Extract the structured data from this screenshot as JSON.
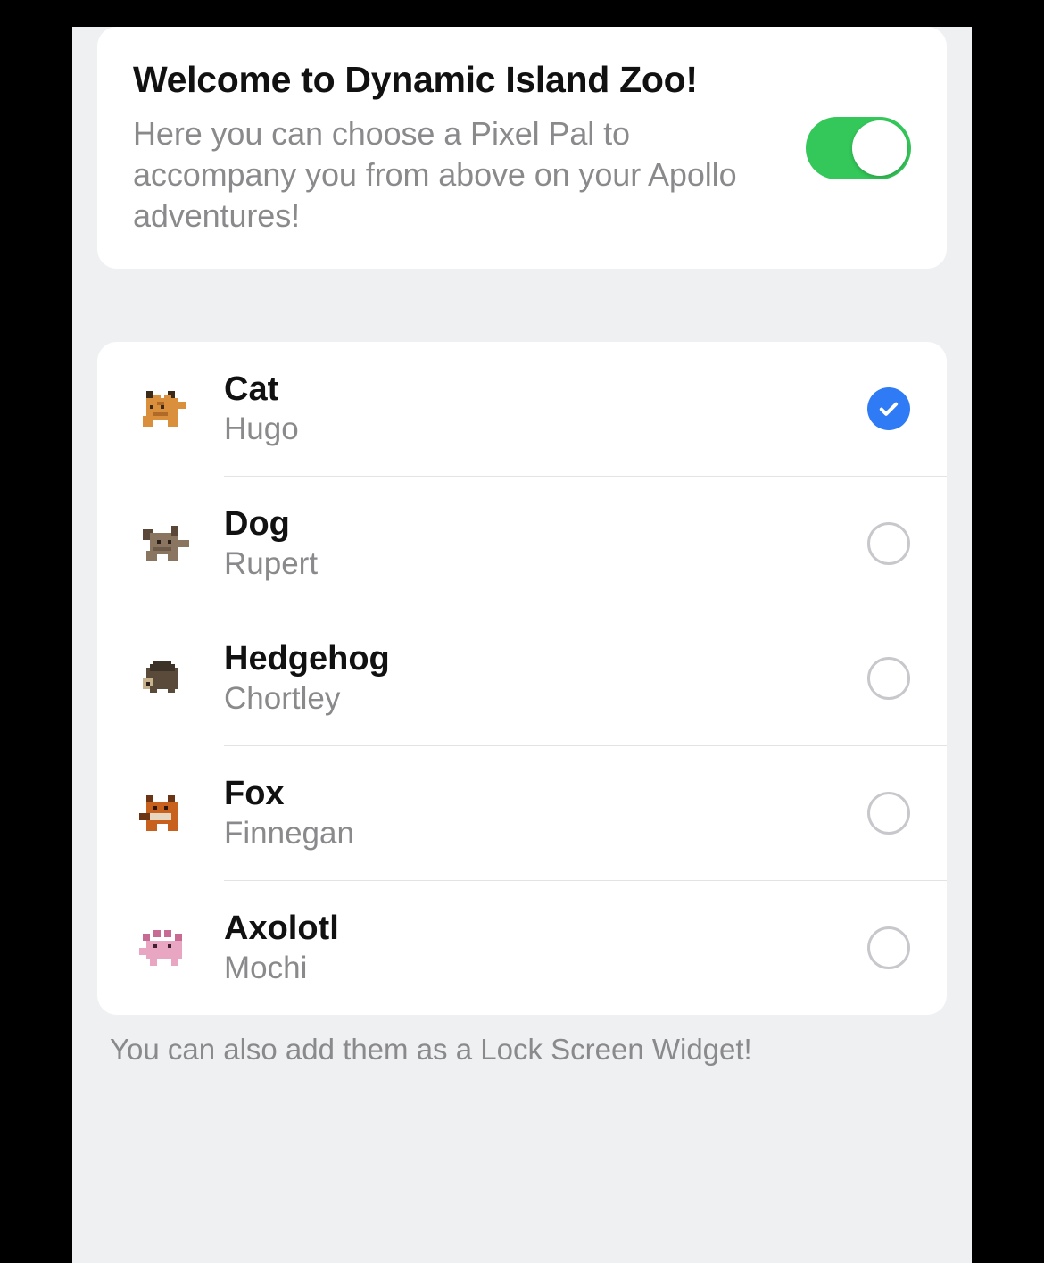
{
  "header": {
    "title": "Welcome to Dynamic Island Zoo!",
    "subtitle": "Here you can choose a Pixel Pal to accompany you from above on your Apollo adventures!",
    "toggle_on": true
  },
  "pals": [
    {
      "species": "Cat",
      "name": "Hugo",
      "selected": true,
      "icon": "cat-icon"
    },
    {
      "species": "Dog",
      "name": "Rupert",
      "selected": false,
      "icon": "dog-icon"
    },
    {
      "species": "Hedgehog",
      "name": "Chortley",
      "selected": false,
      "icon": "hedgehog-icon"
    },
    {
      "species": "Fox",
      "name": "Finnegan",
      "selected": false,
      "icon": "fox-icon"
    },
    {
      "species": "Axolotl",
      "name": "Mochi",
      "selected": false,
      "icon": "axolotl-icon"
    }
  ],
  "footer_note": "You can also add them as a Lock Screen Widget!"
}
